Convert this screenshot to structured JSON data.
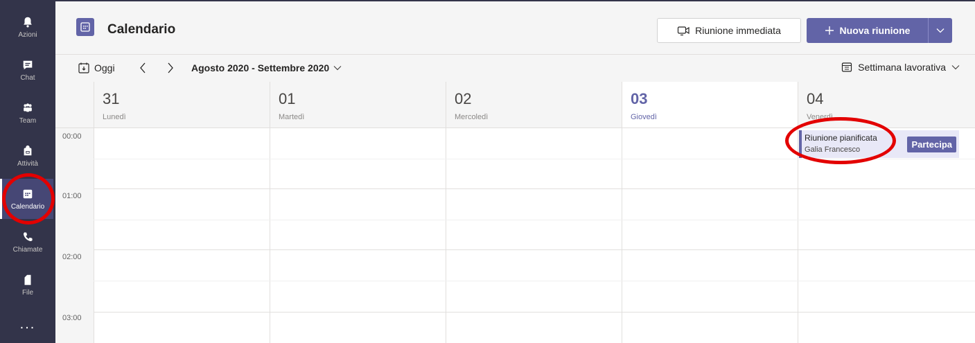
{
  "rail": {
    "items": [
      {
        "label": "Azioni",
        "icon": "bell-icon"
      },
      {
        "label": "Chat",
        "icon": "chat-icon"
      },
      {
        "label": "Team",
        "icon": "team-icon"
      },
      {
        "label": "Attività",
        "icon": "backpack-icon"
      },
      {
        "label": "Calendario",
        "icon": "calendar-icon",
        "active": true
      },
      {
        "label": "Chiamate",
        "icon": "phone-icon"
      },
      {
        "label": "File",
        "icon": "file-icon"
      }
    ],
    "more": "..."
  },
  "header": {
    "title": "Calendario",
    "meet_now_label": "Riunione immediata",
    "new_meeting_label": "Nuova riunione"
  },
  "toolbar": {
    "today_label": "Oggi",
    "range_label": "Agosto 2020 - Settembre 2020",
    "view_label": "Settimana lavorativa"
  },
  "calendar": {
    "days": [
      {
        "num": "31",
        "name": "Lunedì"
      },
      {
        "num": "01",
        "name": "Martedì"
      },
      {
        "num": "02",
        "name": "Mercoledì"
      },
      {
        "num": "03",
        "name": "Giovedì",
        "today": true
      },
      {
        "num": "04",
        "name": "Venerdì"
      }
    ],
    "times": [
      "00:00",
      "01:00",
      "02:00",
      "03:00"
    ],
    "event": {
      "title": "Riunione pianificata",
      "organizer": "Galia Francesco",
      "join_label": "Partecipa"
    }
  },
  "colors": {
    "accent": "#6264a7",
    "rail": "#33344a",
    "annotation": "#e30000"
  }
}
